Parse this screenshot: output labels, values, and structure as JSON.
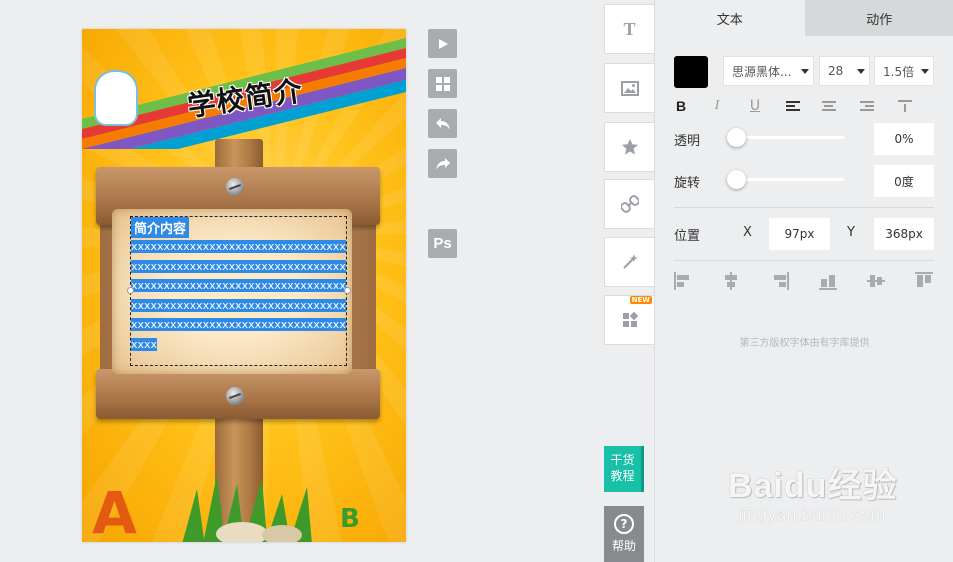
{
  "canvas": {
    "title": "学校简介",
    "text_heading": "简介内容",
    "text_body": "xxxxxxxxxxxxxxxxxxxxxxxxxxxxxxxxxxxxxxxxxxxxxxxxxxxxxxxxxxxxxxxxxxxxxxxxxxxxxxxxxxxxxxxxxxxxxxxxxxxxxxxxxxxxxxxxxxxxxxxxxxxxxxxxxxxxxxxxxxxxxxxxxxxxxxxxxxxxxxxxxxxxxxxxx",
    "letter_a": "A",
    "letter_b": "B"
  },
  "canvas_tools": {
    "play_icon": "play-icon",
    "grid_icon": "grid-icon",
    "undo_icon": "undo-icon",
    "redo_icon": "redo-icon",
    "ps_label": "Ps"
  },
  "tool_column": {
    "text_glyph": "T",
    "new_badge": "NEW",
    "tutorial_line1": "干货",
    "tutorial_line2": "教程",
    "help_glyph": "?",
    "help_label": "帮助"
  },
  "panel": {
    "tabs": [
      {
        "label": "文本",
        "active": true
      },
      {
        "label": "动作",
        "active": false
      }
    ],
    "font_color": "#000000",
    "font_family": "思源黑体...",
    "font_size": "28",
    "line_height": "1.5倍",
    "bold_glyph": "B",
    "italic_glyph": "I",
    "underline_glyph": "U",
    "opacity_label": "透明",
    "opacity_value": "0%",
    "rotation_label": "旋转",
    "rotation_value": "0度",
    "position_label": "位置",
    "x_label": "X",
    "x_value": "97px",
    "y_label": "Y",
    "y_value": "368px",
    "credit": "第三方版权字体由有字库提供"
  },
  "watermark": {
    "main": "Baidu经验",
    "sub": "jingyan.baidu.com"
  }
}
